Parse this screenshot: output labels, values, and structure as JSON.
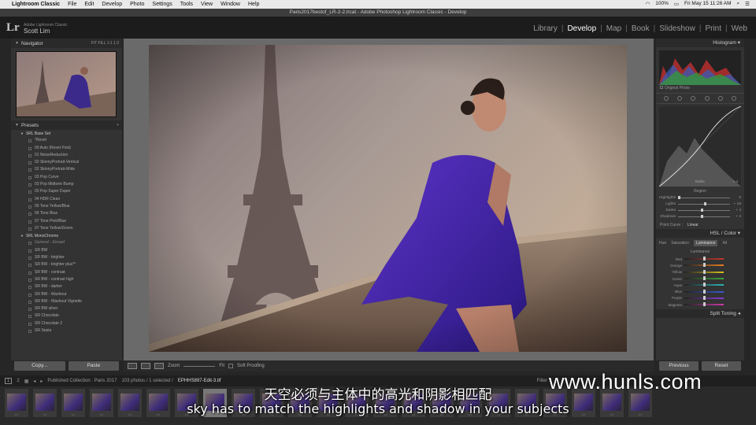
{
  "menubar": {
    "app": "Lightroom Classic",
    "items": [
      "File",
      "Edit",
      "Develop",
      "Photo",
      "Settings",
      "Tools",
      "View",
      "Window",
      "Help"
    ],
    "clock": "Fri May 15  11:26 AM",
    "battery": "100%"
  },
  "window_title": "Paris2017bestof_LR-2-2.lrcat - Adobe Photoshop Lightroom Classic - Develop",
  "identity": {
    "product": "Adobe Lightroom Classic",
    "user": "Scott Lim"
  },
  "modules": [
    "Library",
    "Develop",
    "Map",
    "Book",
    "Slideshow",
    "Print",
    "Web"
  ],
  "active_module": "Develop",
  "left_panel": {
    "navigator_title": "Navigator",
    "navigator_zoom": [
      "FIT",
      "FILL",
      "1:1",
      "1:3"
    ],
    "presets_title": "Presets",
    "presets": [
      {
        "label": "SRL Base Set",
        "folder": true
      },
      {
        "label": "*Reset"
      },
      {
        "label": "00 Auto (Reset First)"
      },
      {
        "label": "01 NoiseReduction"
      },
      {
        "label": "02 SkinnyPortrait-Vertical"
      },
      {
        "label": "02 SkinnyPortrait-Wide"
      },
      {
        "label": "03 Pop Curve"
      },
      {
        "label": "03 Pop Midtone Bump"
      },
      {
        "label": "03 Pop Super Duper"
      },
      {
        "label": "04 HDR Clean"
      },
      {
        "label": "05 Tone Yellow/Blue"
      },
      {
        "label": "06 Tone Blue"
      },
      {
        "label": "07 Tone Pink/Blue"
      },
      {
        "label": "07 Tone Yellow/Green"
      },
      {
        "label": "SRL MonoChrome",
        "folder": true
      },
      {
        "label": "General - Zeroed",
        "italic": true
      },
      {
        "label": "SR BW"
      },
      {
        "label": "SR BW - brighter"
      },
      {
        "label": "SR BW - brighter plus**"
      },
      {
        "label": "SR BW - contrast"
      },
      {
        "label": "SR BW - contrast high"
      },
      {
        "label": "SR BW - darker"
      },
      {
        "label": "SR BW - Washout"
      },
      {
        "label": "SR BW - Washout Vignette"
      },
      {
        "label": "SR BW silver"
      },
      {
        "label": "SR Chocolate"
      },
      {
        "label": "SR Chocolate 2"
      },
      {
        "label": "SR Sepia"
      }
    ],
    "copy_label": "Copy...",
    "paste_label": "Paste"
  },
  "toolbar": {
    "zoom_label": "Zoom",
    "fit_label": "Fit",
    "soft_proofing": "Soft Proofing"
  },
  "right_panel": {
    "histogram_title": "Histogram",
    "original_photo": "Original Photo",
    "curve_region_label": "Darks",
    "curve_region_value": "+ 4",
    "region_title": "Region",
    "region_rows": [
      {
        "label": "Highlights",
        "value": "0",
        "pos": 0
      },
      {
        "label": "Lights",
        "value": "+ 18",
        "pos": 0.59
      },
      {
        "label": "Darks",
        "value": "+ 4",
        "pos": 0.52
      },
      {
        "label": "Shadows",
        "value": "+ 4",
        "pos": 0.52
      }
    ],
    "point_curve_label": "Point Curve :",
    "point_curve_value": "Linear",
    "hsl_title": "HSL / Color",
    "hsl_tabs": [
      "Hue",
      "Saturation",
      "Luminance",
      "All"
    ],
    "hsl_active": "Luminance",
    "luminance_title": "Luminance",
    "hsl_rows": [
      {
        "label": "Red",
        "color": "#c0392b"
      },
      {
        "label": "Orange",
        "color": "#e67e22"
      },
      {
        "label": "Yellow",
        "color": "#d4c21a"
      },
      {
        "label": "Green",
        "color": "#3aa63a"
      },
      {
        "label": "Aqua",
        "color": "#2bb3b3"
      },
      {
        "label": "Blue",
        "color": "#3a5ad4"
      },
      {
        "label": "Purple",
        "color": "#8a3ad4"
      },
      {
        "label": "Magenta",
        "color": "#c93aa6"
      }
    ],
    "split_toning_title": "Split Toning",
    "previous_label": "Previous",
    "reset_label": "Reset"
  },
  "filmstrip_bar": {
    "pages": [
      "1",
      "2"
    ],
    "source": "Published Collection : Paris 2017",
    "count": "103 photos / 1 selected /",
    "filename": "EPHHS897-Edit-3.tif",
    "filter_label": "Filter :"
  },
  "filmstrip_count": 23,
  "watermark": "www.hunls.com",
  "subtitle_cn": "天空必须与主体中的高光和阴影相匹配",
  "subtitle_en": "sky has to match the highlights and shadow in your subjects"
}
